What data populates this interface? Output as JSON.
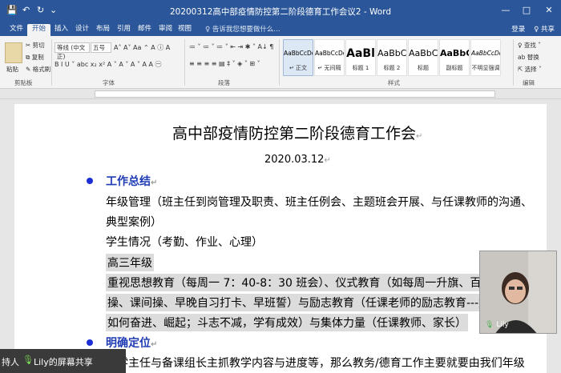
{
  "window": {
    "title": "20200312高中部疫情防控第二阶段德育工作会议2 - Word",
    "controls": [
      "—",
      "□",
      "✕"
    ]
  },
  "quick_access": {
    "save": "💾",
    "undo": "↶",
    "redo": "↻",
    "more": "⌄"
  },
  "menu": {
    "tabs": [
      "文件",
      "开始",
      "插入",
      "设计",
      "布局",
      "引用",
      "邮件",
      "审阅",
      "视图"
    ],
    "active_index": 1,
    "tell_me": "♀ 告诉我您想要做什么...",
    "login": "登录",
    "share": "♀ 共享"
  },
  "ribbon": {
    "clipboard": {
      "label": "剪贴板",
      "paste": "粘贴",
      "cut": "✂ 剪切",
      "copy": "⧉ 复制",
      "format_painter": "✎ 格式刷"
    },
    "font": {
      "label": "字体",
      "font_name": "等线 (中文正)",
      "font_size": "五号",
      "row1_tools": "A˄ A˅ Aa ⌃ A ⓘ A",
      "row2_tools": "B I U ˅ abc x₂ x² A ˅ A ˅ A ˅ A A ㊀"
    },
    "paragraph": {
      "label": "段落",
      "row1_tools": "≔ ˅ ≔ ˅ ≔ ˅ ⇤ ⇥ ✱ ˅ A↓ ¶",
      "row2_tools": "≡ ≡ ≡ ≡ ▤ ‡ ˅ ◈ ˅ ⊞ ˅"
    },
    "styles": {
      "label": "样式",
      "items": [
        {
          "sample": "AaBbCcDd",
          "name": "↵ 正文"
        },
        {
          "sample": "AaBbCcDd",
          "name": "↵ 无间隔"
        },
        {
          "sample": "AaBl",
          "name": "标题 1"
        },
        {
          "sample": "AaBbC",
          "name": "标题 2"
        },
        {
          "sample": "AaBbC",
          "name": "标题"
        },
        {
          "sample": "AaBbC",
          "name": "副标题"
        },
        {
          "sample": "AaBbCcDd",
          "name": "不明显强调"
        }
      ],
      "selected_index": 0
    },
    "editing": {
      "label": "编辑",
      "find": "♀ 查找 ˅",
      "replace": "ab 替换",
      "select": "⇱ 选择 ˅"
    }
  },
  "document": {
    "title": "高中部疫情防控第二阶段德育工作会",
    "title_mark": "↵",
    "date": "2020.03.12",
    "date_mark": "↵",
    "section1_heading": "工作总结",
    "section1_mark": "↵",
    "lines": [
      "年级管理（班主任到岗管理及职责、班主任例会、主题班会开展、与任课教师的沟通、",
      "典型案例）",
      "学生情况（考勤、作业、心理）",
      "高三年级",
      "重视思想教育（每周一 7：40-8：30 班会）、仪式教育（如每周一升旗、百日誓师、",
      "操、课间操、早晚自习打卡、早班誓）与励志教育（任课老师的励志教育---危难之",
      "如何奋进、崛起；斗志不减，学有成效）与集体力量（任课教师、家长）"
    ],
    "section2_heading": "明确定位",
    "section2_mark": "↵",
    "last_line": "教学主任与备课组长主抓教学内容与进度等，那么教务/德育工作主要就要由我们年级"
  },
  "video": {
    "name": "Lily"
  },
  "sharebar": {
    "lead": "持人",
    "text": "Lily的屏幕共享"
  }
}
